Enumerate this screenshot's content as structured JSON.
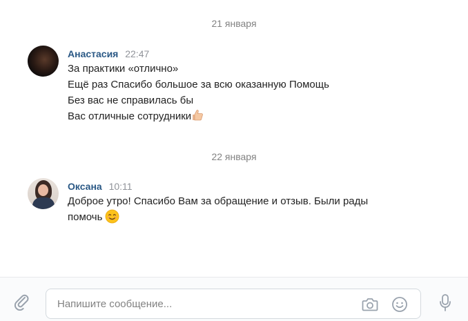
{
  "dates": [
    "21 января",
    "22 января"
  ],
  "messages": [
    {
      "author": "Анастасия",
      "time": "22:47",
      "lines": [
        "За практики «отлично»",
        "Ещё раз Спасибо большое за всю оказанную Помощь",
        "Без вас не справилась бы",
        "Вас отличные сотрудники"
      ],
      "emoji": "thumbs-up"
    },
    {
      "author": "Оксана",
      "time": "10:11",
      "lines": [
        "Доброе утро! Спасибо Вам за обращение и отзыв. Были рады",
        "помочь"
      ],
      "emoji": "smiling-face"
    }
  ],
  "composer": {
    "placeholder": "Напишите сообщение...",
    "icons": [
      "paperclip-icon",
      "camera-icon",
      "smile-icon",
      "microphone-icon"
    ]
  },
  "colors": {
    "author": "#2a5885",
    "secondary_text": "#828282",
    "icon": "#99a2ad"
  }
}
